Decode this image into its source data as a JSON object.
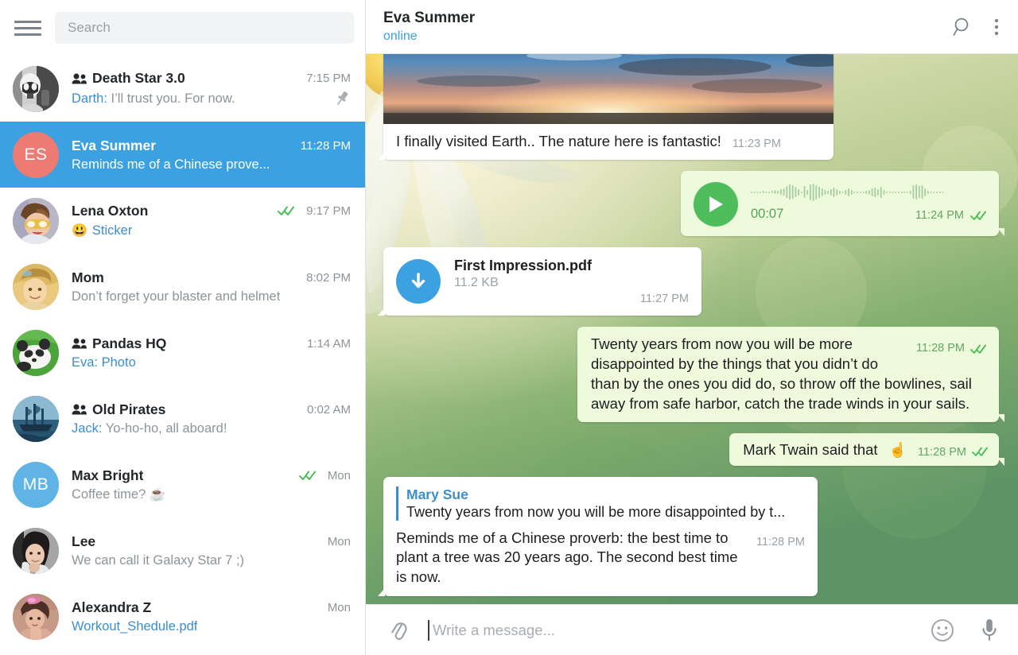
{
  "app": {
    "accent": "#3ba1e0",
    "selected_row_bg": "#3ba1e0",
    "out_bubble_bg": "#eefadc",
    "in_bubble_bg": "#ffffff",
    "link_color": "#3b8ecc",
    "tick_color": "#4ebd5c"
  },
  "sidebar": {
    "menu_icon": "hamburger-icon",
    "search": {
      "placeholder": "Search",
      "value": ""
    },
    "chats": [
      {
        "avatar_kind": "photo-stormtrooper",
        "avatar_initials": "",
        "avatar_color": "#3a3a3a",
        "is_group": true,
        "title": "Death Star 3.0",
        "time": "7:15 PM",
        "sender": "Darth:",
        "preview": "I’ll trust you. For now.",
        "preview_emoji": "",
        "media_label": "",
        "pinned": true,
        "ticks": false,
        "selected": false
      },
      {
        "avatar_kind": "initials",
        "avatar_initials": "ES",
        "avatar_color": "#ed7a73",
        "is_group": false,
        "title": "Eva Summer",
        "time": "11:28 PM",
        "sender": "",
        "preview": "Reminds me of a Chinese prove...",
        "preview_emoji": "",
        "media_label": "",
        "pinned": false,
        "ticks": false,
        "selected": true
      },
      {
        "avatar_kind": "photo-tracer",
        "avatar_initials": "",
        "avatar_color": "#b8b2c8",
        "is_group": false,
        "title": "Lena Oxton",
        "time": "9:17 PM",
        "sender": "",
        "preview": "",
        "preview_emoji": "😃",
        "media_label": "Sticker",
        "pinned": false,
        "ticks": true,
        "selected": false
      },
      {
        "avatar_kind": "photo-mom",
        "avatar_initials": "",
        "avatar_color": "#e8c47a",
        "is_group": false,
        "title": "Mom",
        "time": "8:02 PM",
        "sender": "",
        "preview": "Don’t forget your blaster and helmet",
        "preview_emoji": "",
        "media_label": "",
        "pinned": false,
        "ticks": false,
        "selected": false
      },
      {
        "avatar_kind": "photo-panda",
        "avatar_initials": "",
        "avatar_color": "#5db84f",
        "is_group": true,
        "title": "Pandas HQ",
        "time": "1:14 AM",
        "sender": "Eva:",
        "preview": "",
        "preview_emoji": "",
        "media_label": "Photo",
        "pinned": false,
        "ticks": false,
        "selected": false
      },
      {
        "avatar_kind": "photo-ship",
        "avatar_initials": "",
        "avatar_color": "#2f5f7e",
        "is_group": true,
        "title": "Old Pirates",
        "time": "0:02 AM",
        "sender": "Jack:",
        "preview": "Yo-ho-ho, all aboard!",
        "preview_emoji": "",
        "media_label": "",
        "pinned": false,
        "ticks": false,
        "selected": false
      },
      {
        "avatar_kind": "initials",
        "avatar_initials": "MB",
        "avatar_color": "#5fb4e5",
        "is_group": false,
        "title": "Max Bright",
        "time": "Mon",
        "sender": "",
        "preview": "Coffee time? ☕",
        "preview_emoji": "",
        "media_label": "",
        "pinned": false,
        "ticks": true,
        "selected": false
      },
      {
        "avatar_kind": "photo-lee",
        "avatar_initials": "",
        "avatar_color": "#8d8d8d",
        "is_group": false,
        "title": "Lee",
        "time": "Mon",
        "sender": "",
        "preview": "We can call it Galaxy Star 7 ;)",
        "preview_emoji": "",
        "media_label": "",
        "pinned": false,
        "ticks": false,
        "selected": false
      },
      {
        "avatar_kind": "photo-alexandra",
        "avatar_initials": "",
        "avatar_color": "#c49a8b",
        "is_group": false,
        "title": "Alexandra Z",
        "time": "Mon",
        "sender": "",
        "preview": "",
        "preview_emoji": "",
        "media_label": "Workout_Shedule.pdf",
        "pinned": false,
        "ticks": false,
        "selected": false
      }
    ]
  },
  "chat": {
    "header": {
      "name": "Eva Summer",
      "status": "online",
      "search_icon": "search-icon",
      "more_icon": "more-vertical-icon"
    },
    "messages": {
      "photo": {
        "caption": "I finally visited Earth.. The nature here is fantastic!",
        "time": "11:23 PM",
        "alt": "sunset-photo"
      },
      "voice": {
        "duration": "00:07",
        "time": "11:24 PM",
        "read": true
      },
      "file": {
        "name": "First Impression.pdf",
        "size": "11.2 KB",
        "time": "11:27 PM",
        "download_icon": "download-arrow-icon"
      },
      "quote_long": {
        "text": "Twenty years from now you will be more disappointed by the things that you didn’t do than by the ones you did do, so throw off the bowlines, sail away from safe harbor, catch the trade winds in your sails.",
        "time": "11:28 PM",
        "read": true
      },
      "attribution": {
        "text": "Mark Twain said that",
        "emoji": "☝",
        "time": "11:28 PM",
        "read": true
      },
      "reply": {
        "author": "Mary Sue",
        "snippet": "Twenty years from now you will be more disappointed by t...",
        "text": "Reminds me of a Chinese proverb: the best time to plant a tree was 20 years ago. The second best time is now.",
        "time": "11:28 PM"
      }
    },
    "composer": {
      "attach_icon": "paperclip-icon",
      "placeholder": "Write a message...",
      "value": "",
      "emoji_icon": "smiley-icon",
      "mic_icon": "microphone-icon"
    }
  }
}
